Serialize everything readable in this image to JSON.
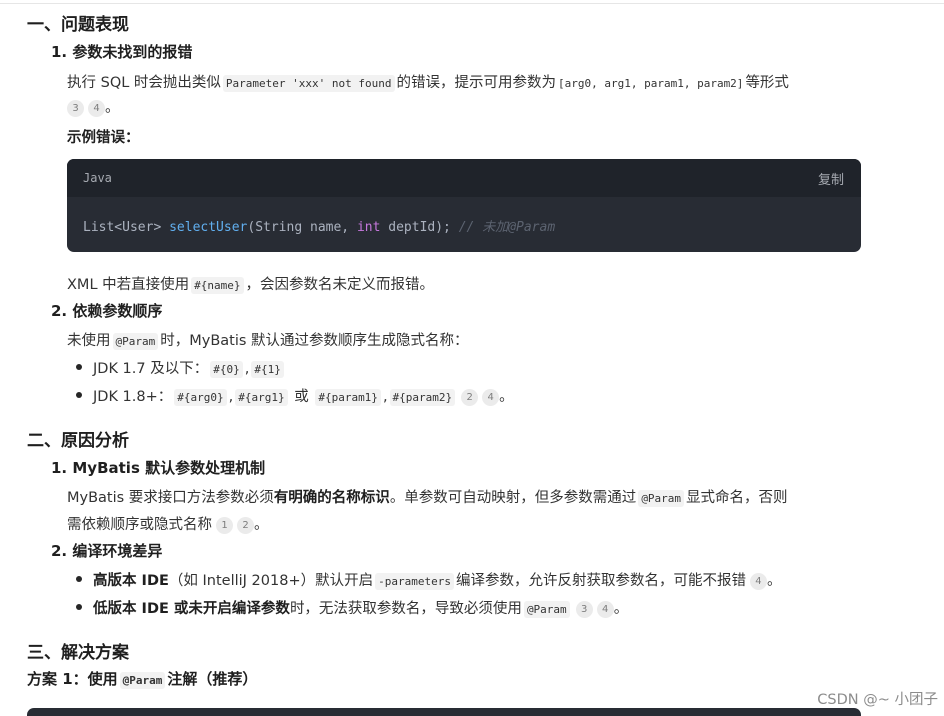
{
  "s1": {
    "title": "一、问题表现",
    "item1": {
      "num": "1.",
      "title": "参数未找到的报错",
      "line1_pre": "执行 SQL 时会抛出类似",
      "line1_code": "Parameter 'xxx' not found",
      "line1_mid": "的错误，提示可用参数为",
      "line1_code2": "[arg0, arg1, param1, param2]",
      "line1_post": "等形式",
      "cite_a": "3",
      "cite_b": "4",
      "line2_end": "。",
      "example_label": "示例错误：",
      "code": {
        "lang": "Java",
        "copy": "复制",
        "t1": "List<User> ",
        "fn": "selectUser",
        "t2": "(String name, ",
        "kw": "int",
        "t3": " deptId); ",
        "comment": "// 未加@Param"
      },
      "after_pre": "XML 中若直接使用",
      "after_code": "#{name}",
      "after_post": "，会因参数名未定义而报错。"
    },
    "item2": {
      "num": "2.",
      "title": "依赖参数顺序",
      "line_pre": "未使用",
      "line_code": "@Param",
      "line_post": "时，MyBatis 默认通过参数顺序生成隐式名称：",
      "b1_pre": "JDK 1.7 及以下：",
      "b1_c1": "#{0}",
      "b1_sep": ",",
      "b1_c2": "#{1}",
      "b2_pre": "JDK 1.8+：",
      "b2_c1": "#{arg0}",
      "b2_sep1": ",",
      "b2_c2": "#{arg1}",
      "b2_or": "或",
      "b2_c3": "#{param1}",
      "b2_sep2": ",",
      "b2_c4": "#{param2}",
      "cite_a": "2",
      "cite_b": "4",
      "end": "。"
    }
  },
  "s2": {
    "title": "二、原因分析",
    "item1": {
      "num": "1.",
      "title": "MyBatis 默认参数处理机制",
      "l1_pre": "MyBatis 要求接口方法参数必须",
      "l1_bold": "有明确的名称标识",
      "l1_mid": "。单参数可自动映射，但多参数需通过",
      "l1_code": "@Param",
      "l1_post": "显式命名，否则",
      "l2_text": "需依赖顺序或隐式名称",
      "cite_a": "1",
      "cite_b": "2",
      "end": "。"
    },
    "item2": {
      "num": "2.",
      "title": "编译环境差异",
      "b1_bold": "高版本 IDE",
      "b1_mid": "（如 IntelliJ 2018+）默认开启",
      "b1_code": "-parameters",
      "b1_post": "编译参数，允许反射获取参数名，可能不报错",
      "b1_cite": "4",
      "b1_end": "。",
      "b2_bold": "低版本 IDE 或未开启编译参数",
      "b2_mid": "时，无法获取参数名，导致必须使用",
      "b2_code": "@Param",
      "cite_a": "3",
      "cite_b": "4",
      "end": "。"
    }
  },
  "s3": {
    "title": "三、解决方案",
    "plan_pre": "方案 1：使用",
    "plan_code": "@Param",
    "plan_post": "注解（推荐）"
  },
  "watermark": "CSDN @~ 小团子",
  "colors": {
    "code_bg": "#282c34",
    "code_header": "#1f232a",
    "fn": "#61afef",
    "kw": "#c678dd",
    "comment": "#5c6370"
  }
}
